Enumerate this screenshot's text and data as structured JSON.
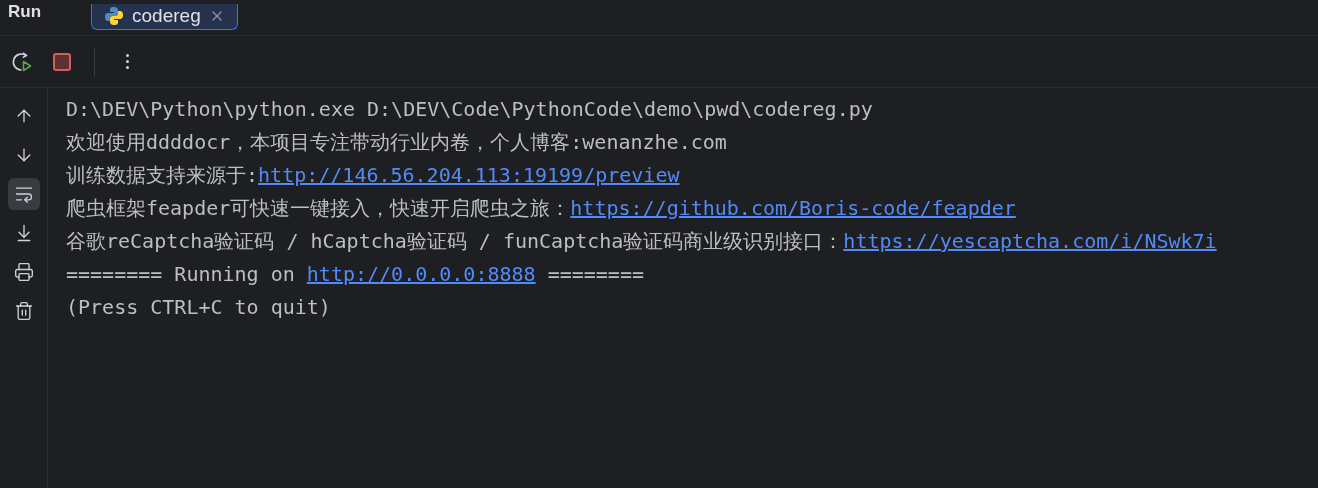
{
  "panel": {
    "title": "Run"
  },
  "tabs": [
    {
      "label": "codereg",
      "selected": true
    }
  ],
  "toolbar": [
    {
      "kind": "rerun"
    },
    {
      "kind": "stop"
    },
    {
      "kind": "more"
    }
  ],
  "side_tools": [
    {
      "kind": "up",
      "selected": false
    },
    {
      "kind": "down",
      "selected": false
    },
    {
      "kind": "wrap",
      "selected": true
    },
    {
      "kind": "scroll-end",
      "selected": false
    },
    {
      "kind": "print",
      "selected": false
    },
    {
      "kind": "clear",
      "selected": false
    }
  ],
  "console": [
    {
      "segments": [
        {
          "kind": "text",
          "text": "D:\\DEV\\Python\\python.exe D:\\DEV\\Code\\PythonCode\\demo\\pwd\\codereg.py"
        }
      ]
    },
    {
      "segments": [
        {
          "kind": "text",
          "text": "欢迎使用ddddocr，本项目专注带动行业内卷，个人博客:wenanzhe.com"
        }
      ]
    },
    {
      "segments": [
        {
          "kind": "text",
          "text": "训练数据支持来源于:"
        },
        {
          "kind": "link",
          "text": "http://146.56.204.113:19199/preview"
        }
      ]
    },
    {
      "segments": [
        {
          "kind": "text",
          "text": "爬虫框架feapder可快速一键接入，快速开启爬虫之旅："
        },
        {
          "kind": "link",
          "text": "https://github.com/Boris-code/feapder"
        }
      ]
    },
    {
      "segments": [
        {
          "kind": "text",
          "text": "谷歌reCaptcha验证码 / hCaptcha验证码 / funCaptcha验证码商业级识别接口："
        },
        {
          "kind": "link",
          "text": "https://yescaptcha.com/i/NSwk7i"
        }
      ]
    },
    {
      "segments": [
        {
          "kind": "text",
          "text": "======== Running on "
        },
        {
          "kind": "link",
          "text": "http://0.0.0.0:8888"
        },
        {
          "kind": "text",
          "text": " ========"
        }
      ]
    },
    {
      "segments": [
        {
          "kind": "text",
          "text": "(Press CTRL+C to quit)"
        }
      ]
    }
  ]
}
